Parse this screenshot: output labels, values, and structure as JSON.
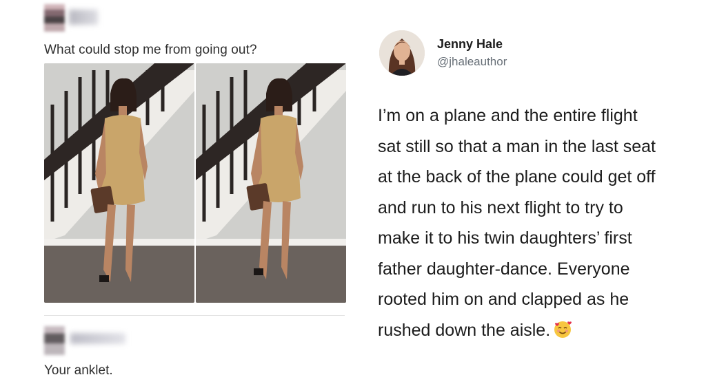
{
  "left_post": {
    "question": "What could stop me from going out?",
    "reply": "Your anklet."
  },
  "tweet": {
    "display_name": "Jenny Hale",
    "handle": "@jhaleauthor",
    "lines": [
      "I’m on a plane and the entire flight",
      "sat still so that a man in the last seat",
      "at the back of the plane could get off",
      "and run to his next flight to try to",
      "make it to his twin daughters’ first",
      "father daughter-dance. Everyone",
      "rooted him on and clapped as he",
      "rushed down the aisle."
    ],
    "emoji": "smiling-face-with-hearts-icon"
  },
  "colors": {
    "text": "#2f2f2f",
    "handle": "#687078",
    "dress": "#c9a56a"
  }
}
